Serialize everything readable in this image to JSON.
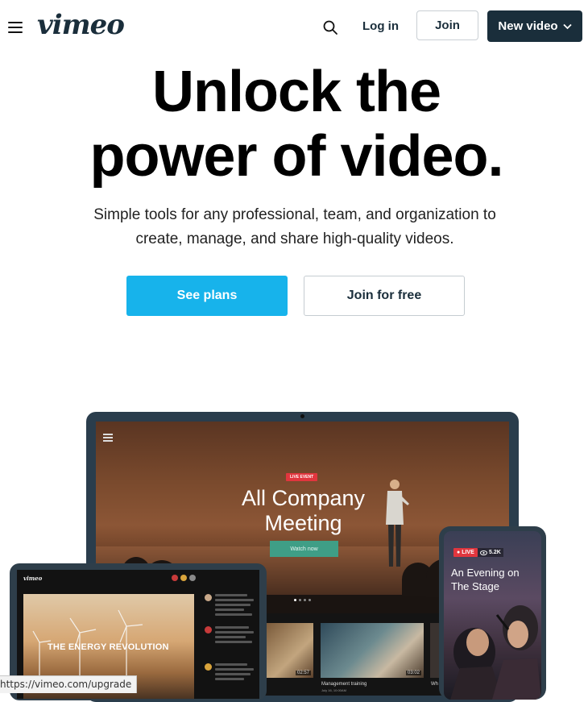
{
  "header": {
    "logo": "vimeo",
    "login": "Log in",
    "join": "Join",
    "new_video": "New video"
  },
  "hero": {
    "title_line1": "Unlock the",
    "title_line2": "power of video.",
    "subtitle_line1": "Simple tools for any professional, team, and organization to",
    "subtitle_line2": "create, manage, and share high-quality videos.",
    "cta_primary": "See plans",
    "cta_secondary": "Join for free"
  },
  "mockup": {
    "laptop": {
      "badge": "LIVE EVENT",
      "title_line1": "All Company",
      "title_line2": "Meeting",
      "watch_button": "Watch now",
      "thumbs": [
        {
          "duration": "02:57"
        },
        {
          "title": "Management training",
          "date": "July 16, 10:00AM",
          "duration": "03:02"
        },
        {
          "title": "Wh"
        }
      ]
    },
    "tablet": {
      "logo": "vimeo",
      "video_title": "THE ENERGY REVOLUTION"
    },
    "phone": {
      "live_badge": "LIVE",
      "viewers": "5.2K",
      "title": "An Evening on The Stage"
    }
  },
  "status_bar": {
    "url": "https://vimeo.com/upgrade"
  },
  "colors": {
    "brand_dark": "#1a2e3b",
    "accent_blue": "#17b3eb",
    "live_red": "#e1363e",
    "watch_green": "#3f9e86"
  }
}
